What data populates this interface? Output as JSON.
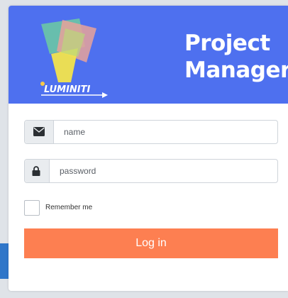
{
  "app": {
    "logo_text": "LUMINITI",
    "title_line1": "Project",
    "title_line2": "Manager"
  },
  "form": {
    "name_placeholder": "name",
    "password_placeholder": "password",
    "remember_label": "Remember me",
    "remember_checked": false,
    "login_label": "Log in"
  },
  "icons": {
    "name_field": "envelope-icon",
    "password_field": "lock-icon"
  },
  "colors": {
    "header": "#4e70ef",
    "login_button": "#fd7f51",
    "side_accent": "#2f76c9"
  }
}
